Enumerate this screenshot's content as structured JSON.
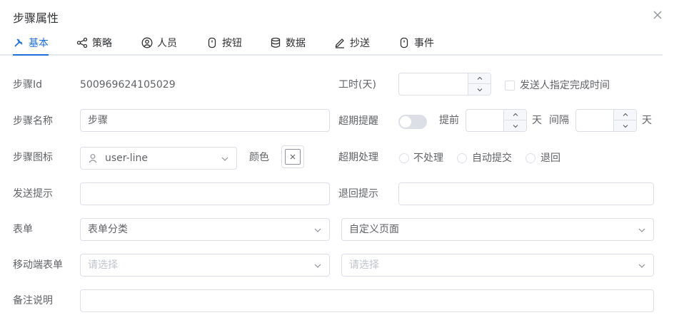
{
  "dialog": {
    "title": "步骤属性"
  },
  "tabs": [
    {
      "label": "基本",
      "icon": "tools-icon",
      "active": true
    },
    {
      "label": "策略",
      "icon": "share-icon"
    },
    {
      "label": "人员",
      "icon": "user-icon"
    },
    {
      "label": "按钮",
      "icon": "button-icon"
    },
    {
      "label": "数据",
      "icon": "database-icon"
    },
    {
      "label": "抄送",
      "icon": "pen-icon"
    },
    {
      "label": "事件",
      "icon": "event-icon"
    }
  ],
  "form": {
    "step_id": {
      "label": "步骤Id",
      "value": "500969624105029"
    },
    "work_hours": {
      "label": "工时(天)",
      "value": ""
    },
    "sender_specify_time": {
      "label": "发送人指定完成时间",
      "checked": false
    },
    "step_name": {
      "label": "步骤名称",
      "value": "步骤"
    },
    "overdue_remind": {
      "label": "超期提醒",
      "enabled": false,
      "advance_label": "提前",
      "advance_value": "",
      "advance_unit": "天",
      "interval_label": "间隔",
      "interval_value": "",
      "interval_unit": "天"
    },
    "step_icon": {
      "label": "步骤图标",
      "value": "user-line",
      "icon": "user-icon"
    },
    "color": {
      "label": "颜色",
      "value": "none"
    },
    "overdue_handle": {
      "label": "超期处理",
      "options": [
        "不处理",
        "自动提交",
        "退回"
      ],
      "selected": null
    },
    "send_tip": {
      "label": "发送提示",
      "value": ""
    },
    "return_tip": {
      "label": "退回提示",
      "value": ""
    },
    "form_select": {
      "label": "表单",
      "category": "表单分类",
      "page": "自定义页面"
    },
    "mobile_form": {
      "label": "移动端表单",
      "category_placeholder": "请选择",
      "page_placeholder": "请选择"
    },
    "remark": {
      "label": "备注说明",
      "value": ""
    }
  },
  "colors": {
    "accent": "#1e6fd9",
    "border": "#dcdfe6",
    "label": "#606266",
    "placeholder": "#c0c4cc"
  }
}
